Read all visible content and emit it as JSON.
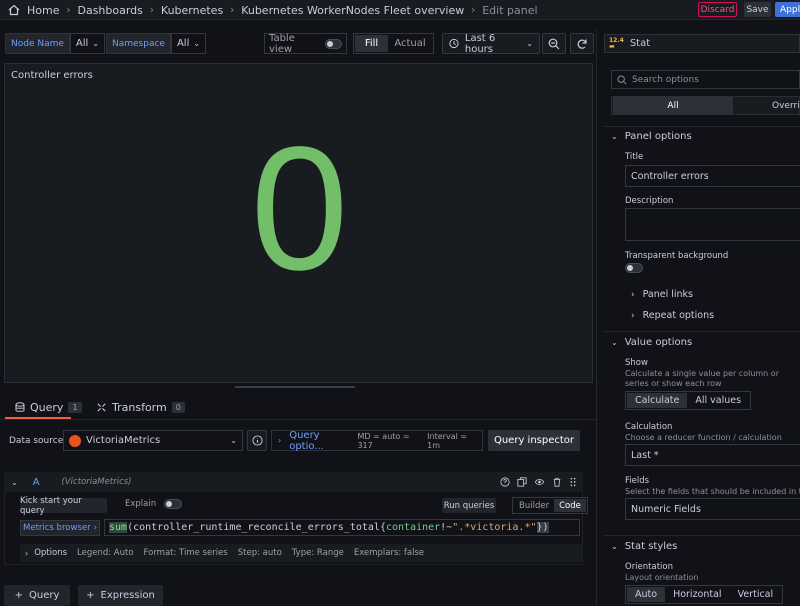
{
  "topbar": {
    "breadcrumb": [
      "Home",
      "Dashboards",
      "Kubernetes",
      "Kubernetes WorkerNodes Fleet overview",
      "Edit panel"
    ],
    "discard_label": "Discard",
    "save_label": "Save",
    "apply_label": "Apply"
  },
  "variables": [
    {
      "label": "Node Name",
      "value": "All"
    },
    {
      "label": "Namespace",
      "value": "All"
    }
  ],
  "toolbar": {
    "table_view_label": "Table view",
    "fill_label": "Fill",
    "actual_label": "Actual",
    "time_range": "Last 6 hours"
  },
  "panel": {
    "title": "Controller errors",
    "value": "0",
    "value_color": "#73bf69"
  },
  "tabs": [
    {
      "label": "Query",
      "count": "1"
    },
    {
      "label": "Transform",
      "count": "0"
    }
  ],
  "datasource": {
    "label": "Data source",
    "name": "VictoriaMetrics",
    "query_options_label": "Query optio...",
    "md_text": "MD = auto = 317",
    "interval_text": "Interval = 1m",
    "query_inspector_label": "Query inspector"
  },
  "query": {
    "ref_id": "A",
    "ds_hint": "(VictoriaMetrics)",
    "kickstart_label": "Kick start your query",
    "explain_label": "Explain",
    "run_label": "Run queries",
    "builder_label": "Builder",
    "code_label": "Code",
    "metrics_browser_label": "Metrics browser",
    "expr": {
      "fn": "sum",
      "open": "(",
      "metric": "controller_runtime_reconcile_errors_total",
      "brace_open": "{",
      "label_name": "container",
      "op": "!~",
      "label_value": "\".*victoria.*\"",
      "close": "})"
    },
    "options": {
      "title": "Options",
      "legend": "Legend: Auto",
      "format": "Format: Time series",
      "step": "Step: auto",
      "type": "Type: Range",
      "exemplars": "Exemplars: false"
    }
  },
  "bottom": {
    "add_query_label": "Query",
    "add_expression_label": "Expression"
  },
  "options_pane": {
    "viz_name": "Stat",
    "search_placeholder": "Search options",
    "tab_all": "All",
    "tab_overrides": "Overrides",
    "panel_options": {
      "title": "Panel options",
      "title_label": "Title",
      "title_value": "Controller errors",
      "description_label": "Description",
      "transparent_label": "Transparent background",
      "panel_links": "Panel links",
      "repeat_options": "Repeat options"
    },
    "value_options": {
      "title": "Value options",
      "show_label": "Show",
      "show_desc": "Calculate a single value per column or series or show each row",
      "calculate": "Calculate",
      "all_values": "All values",
      "calculation_label": "Calculation",
      "calculation_desc": "Choose a reducer function / calculation",
      "calculation_value": "Last *",
      "fields_label": "Fields",
      "fields_desc": "Select the fields that should be included in the panel",
      "fields_value": "Numeric Fields"
    },
    "stat_styles": {
      "title": "Stat styles",
      "orientation_label": "Orientation",
      "orientation_desc": "Layout orientation",
      "auto": "Auto",
      "horizontal": "Horizontal",
      "vertical": "Vertical"
    }
  }
}
